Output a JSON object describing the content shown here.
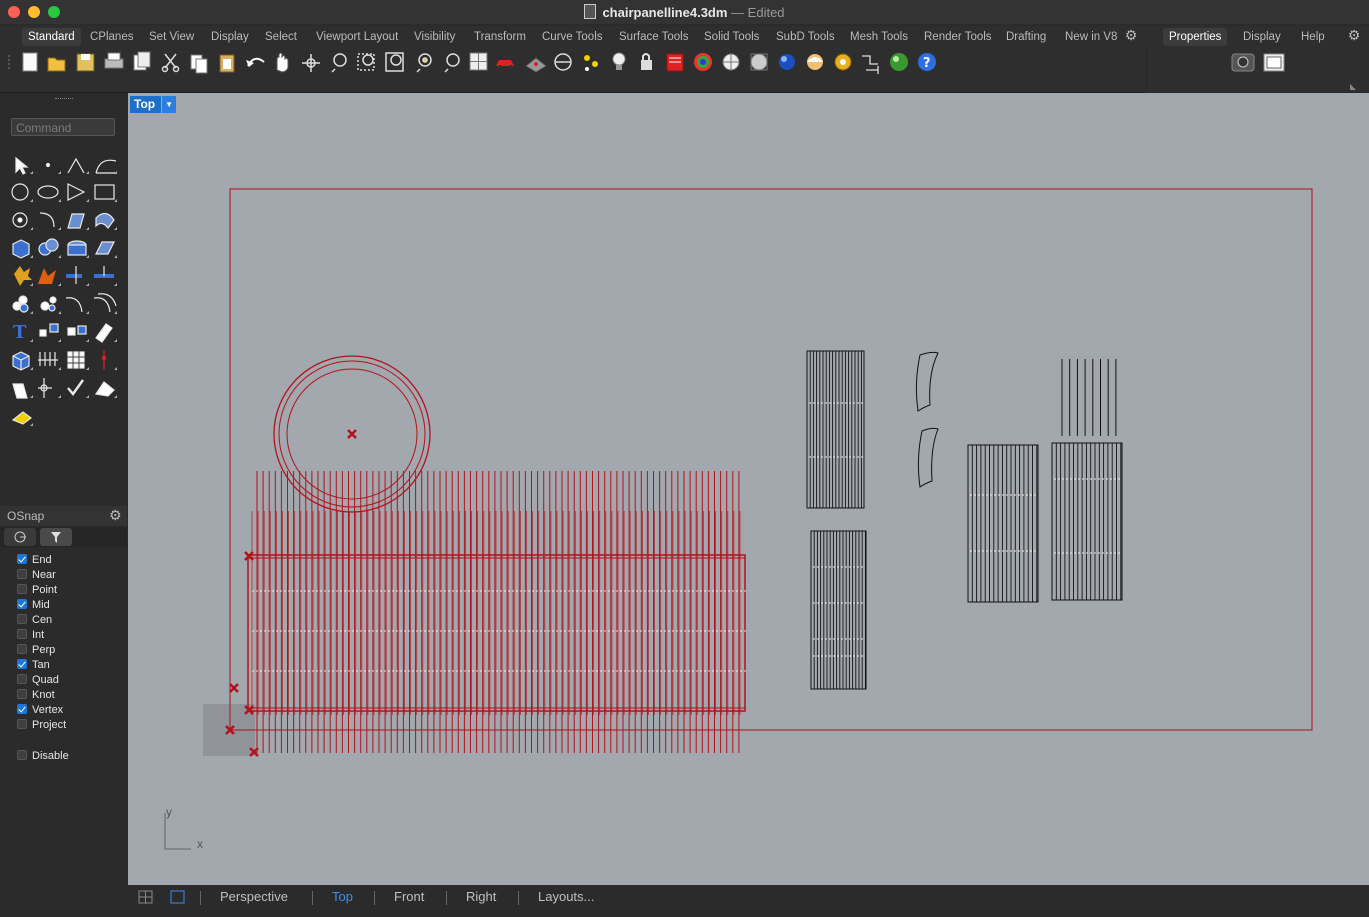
{
  "window": {
    "title": "chairpanelline4.3dm",
    "status": "— Edited",
    "traffic_lights": {
      "close": "#ff5f57",
      "minimize": "#febc2e",
      "zoom": "#28c840"
    }
  },
  "top_tabs": [
    {
      "label": "Standard",
      "active": true
    },
    {
      "label": "CPlanes"
    },
    {
      "label": "Set View"
    },
    {
      "label": "Display"
    },
    {
      "label": "Select"
    },
    {
      "label": "Viewport Layout"
    },
    {
      "label": "Visibility"
    },
    {
      "label": "Transform"
    },
    {
      "label": "Curve Tools"
    },
    {
      "label": "Surface Tools"
    },
    {
      "label": "Solid Tools"
    },
    {
      "label": "SubD Tools"
    },
    {
      "label": "Mesh Tools"
    },
    {
      "label": "Render Tools"
    },
    {
      "label": "Drafting"
    },
    {
      "label": "New in V8"
    }
  ],
  "panel_tabs": [
    {
      "label": "Properties",
      "active": true
    },
    {
      "label": "Display"
    },
    {
      "label": "Help"
    }
  ],
  "command": {
    "placeholder": "Command"
  },
  "viewport": {
    "name": "Top",
    "axis": {
      "x": "x",
      "y": "y"
    },
    "colors": {
      "background": "#a3a7ae",
      "selected": "#b2121a",
      "curve": "#111111",
      "boundary": "#b2121a"
    }
  },
  "osnap": {
    "title": "OSnap",
    "items": [
      {
        "label": "End",
        "checked": true
      },
      {
        "label": "Near",
        "checked": false
      },
      {
        "label": "Point",
        "checked": false
      },
      {
        "label": "Mid",
        "checked": true
      },
      {
        "label": "Cen",
        "checked": false
      },
      {
        "label": "Int",
        "checked": false
      },
      {
        "label": "Perp",
        "checked": false
      },
      {
        "label": "Tan",
        "checked": true
      },
      {
        "label": "Quad",
        "checked": false
      },
      {
        "label": "Knot",
        "checked": false
      },
      {
        "label": "Vertex",
        "checked": true
      },
      {
        "label": "Project",
        "checked": false
      }
    ],
    "disable": {
      "label": "Disable",
      "checked": false
    }
  },
  "bottom_tabs": [
    {
      "label": "Perspective"
    },
    {
      "label": "Top",
      "active": true
    },
    {
      "label": "Front"
    },
    {
      "label": "Right"
    },
    {
      "label": "Layouts..."
    }
  ]
}
